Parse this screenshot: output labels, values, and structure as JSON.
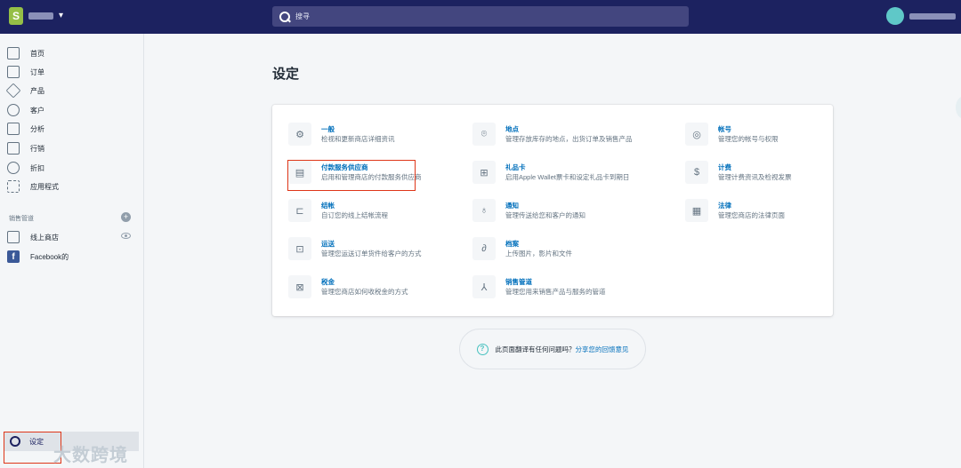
{
  "topbar": {
    "search_placeholder": "搜寻"
  },
  "sidebar": {
    "items": [
      {
        "label": "首页",
        "icon": "home-icon"
      },
      {
        "label": "订单",
        "icon": "orders-icon"
      },
      {
        "label": "产品",
        "icon": "tag-icon"
      },
      {
        "label": "客户",
        "icon": "person-icon"
      },
      {
        "label": "分析",
        "icon": "bar-chart-icon"
      },
      {
        "label": "行销",
        "icon": "megaphone-icon"
      },
      {
        "label": "折扣",
        "icon": "discount-icon"
      },
      {
        "label": "应用程式",
        "icon": "apps-icon"
      }
    ],
    "sales_channels_title": "销售管道",
    "channels": [
      {
        "label": "线上商店",
        "icon": "store-icon"
      },
      {
        "label": "Facebook的",
        "icon": "facebook-icon"
      }
    ],
    "settings_label": "设定",
    "watermark": "大数跨境"
  },
  "main": {
    "title": "设定",
    "settings": [
      {
        "title": "一般",
        "desc": "检视和更新商店详细资讯",
        "icon": "gear-icon"
      },
      {
        "title": "地点",
        "desc": "管理存放库存的地点，出货订单及销售产品",
        "icon": "location-pin-icon"
      },
      {
        "title": "帐号",
        "desc": "管理您的帐号与权限",
        "icon": "account-icon"
      },
      {
        "title": "付款服务供应商",
        "desc": "启用和管理商店的付款服务供应商",
        "icon": "payment-icon"
      },
      {
        "title": "礼品卡",
        "desc": "启用Apple Wallet票卡和设定礼品卡到期日",
        "icon": "gift-icon"
      },
      {
        "title": "计费",
        "desc": "管理计费资讯及检视发票",
        "icon": "billing-icon"
      },
      {
        "title": "结帐",
        "desc": "自订您的线上结帐流程",
        "icon": "cart-icon"
      },
      {
        "title": "通知",
        "desc": "管理传送给您和客户的通知",
        "icon": "bell-icon"
      },
      {
        "title": "法律",
        "desc": "管理您商店的法律页面",
        "icon": "legal-icon"
      },
      {
        "title": "运送",
        "desc": "管理您运送订单货件给客户的方式",
        "icon": "truck-icon"
      },
      {
        "title": "档案",
        "desc": "上传图片，影片和文件",
        "icon": "paperclip-icon"
      },
      {
        "title": "税金",
        "desc": "管理您商店如何收税金的方式",
        "icon": "tax-icon"
      },
      {
        "title": "销售管道",
        "desc": "管理您用来销售产品与服务的管道",
        "icon": "channels-icon"
      }
    ],
    "feedback_text": "此页面翻译有任何问题吗？",
    "feedback_link": "分享您的回馈意见"
  }
}
